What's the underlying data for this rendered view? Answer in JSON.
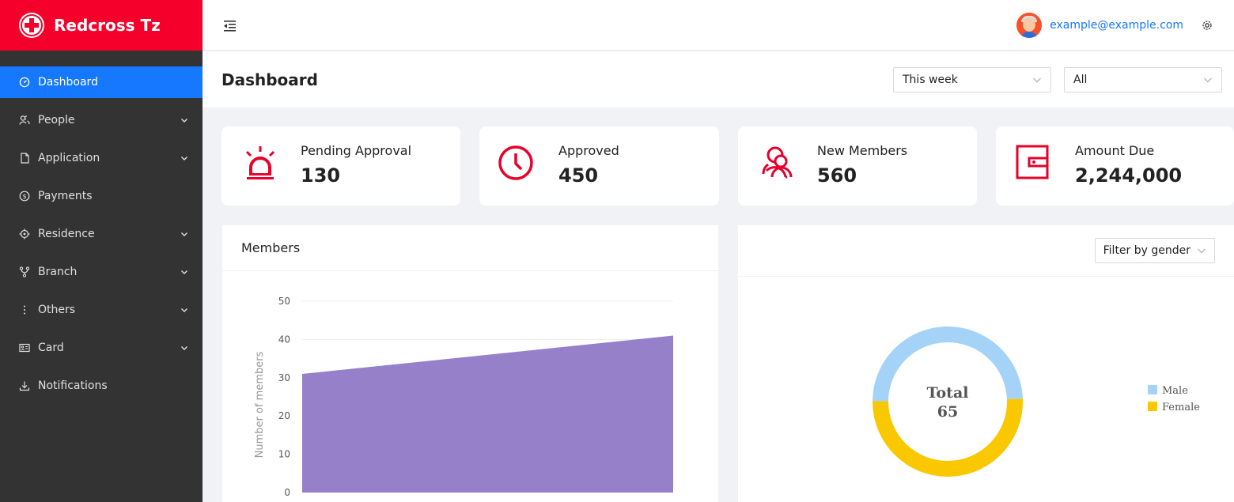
{
  "brand": {
    "title": "Redcross Tz"
  },
  "sidebar": {
    "items": [
      {
        "label": "Dashboard",
        "icon": "dashboard-icon",
        "active": true,
        "has_children": false
      },
      {
        "label": "People",
        "icon": "people-icon",
        "active": false,
        "has_children": true
      },
      {
        "label": "Application",
        "icon": "file-icon",
        "active": false,
        "has_children": true
      },
      {
        "label": "Payments",
        "icon": "dollar-icon",
        "active": false,
        "has_children": false
      },
      {
        "label": "Residence",
        "icon": "aim-icon",
        "active": false,
        "has_children": true
      },
      {
        "label": "Branch",
        "icon": "branch-icon",
        "active": false,
        "has_children": true
      },
      {
        "label": "Others",
        "icon": "more-icon",
        "active": false,
        "has_children": true
      },
      {
        "label": "Card",
        "icon": "idcard-icon",
        "active": false,
        "has_children": true
      },
      {
        "label": "Notifications",
        "icon": "download-icon",
        "active": false,
        "has_children": false
      }
    ]
  },
  "header": {
    "user_email": "example@example.com"
  },
  "page": {
    "title": "Dashboard",
    "period_select": "This week",
    "scope_select": "All"
  },
  "stats": [
    {
      "title": "Pending Approval",
      "value": "130",
      "icon": "alert-icon"
    },
    {
      "title": "Approved",
      "value": "450",
      "icon": "clock-icon"
    },
    {
      "title": "New Members",
      "value": "560",
      "icon": "users-icon"
    },
    {
      "title": "Amount Due",
      "value": "2,244,000",
      "icon": "wallet-icon"
    }
  ],
  "members_panel": {
    "title": "Members"
  },
  "gender_panel": {
    "filter_label": "Filter by gender",
    "total_label": "Total",
    "total_value": "65"
  },
  "colors": {
    "brand": "#f5002a",
    "accent": "#1677ff",
    "sidebar": "#333333",
    "area": "#9580c9",
    "male": "#a5d3f7",
    "female": "#fac800"
  },
  "chart_data": [
    {
      "type": "area",
      "title": "",
      "ylabel": "Number of members",
      "xlabel": "",
      "ylim": [
        0,
        50
      ],
      "yticks": [
        0,
        10,
        20,
        30,
        40,
        50
      ],
      "x": [
        0,
        1
      ],
      "series": [
        {
          "values": [
            31,
            41
          ]
        }
      ],
      "grid": true
    },
    {
      "type": "pie",
      "donut": true,
      "center_text": [
        "Total",
        "65"
      ],
      "categories": [
        "Male",
        "Female"
      ],
      "values": [
        32,
        33
      ],
      "legend": "right"
    }
  ]
}
